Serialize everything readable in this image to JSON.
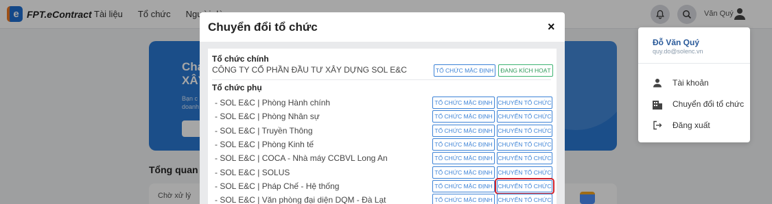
{
  "app": {
    "logo_text": "FPT.eContract",
    "logo_letter": "e",
    "nav": [
      "Tài liệu",
      "Tổ chức",
      "Người dùng"
    ],
    "user_name": "Văn Quý",
    "colors": {
      "brand": "#1f6fd1",
      "accent": "#f07a23",
      "highlight": "#d0202a"
    }
  },
  "background": {
    "hero_title_1": "Chả",
    "hero_title_2": "XÂY",
    "hero_sub_1": "Bạn c",
    "hero_sub_2": "doanh",
    "section_title": "Tổng quan",
    "card_label": "Chờ xử lý"
  },
  "user_menu": {
    "name": "Đỗ Văn Quý",
    "email": "quy.do@solenc.vn",
    "items": [
      {
        "label": "Tài khoản",
        "icon": "user-icon"
      },
      {
        "label": "Chuyển đổi tổ chức",
        "icon": "building-icon"
      },
      {
        "label": "Đăng xuất",
        "icon": "logout-icon"
      }
    ]
  },
  "modal": {
    "title": "Chuyển đổi tổ chức",
    "close": "×",
    "main_heading": "Tổ chức chính",
    "main_org": "CÔNG TY CỔ PHẦN ĐẦU TƯ XÂY DỰNG SOL E&C",
    "main_default_btn": "TỔ CHỨC MẶC ĐỊNH",
    "main_active_btn": "ĐANG KÍCH HOẠT",
    "sub_heading": "Tổ chức phụ",
    "default_btn": "TỔ CHỨC MẶC ĐỊNH",
    "switch_btn": "CHUYỂN TỔ CHỨC",
    "sub_orgs": [
      {
        "name": "-  SOL E&C | Phòng Hành chính",
        "highlighted": false
      },
      {
        "name": "-  SOL E&C | Phòng Nhân sự",
        "highlighted": false
      },
      {
        "name": "-  SOL E&C | Truyền Thông",
        "highlighted": false
      },
      {
        "name": "-  SOL E&C | Phòng Kinh tế",
        "highlighted": false
      },
      {
        "name": "-  SOL E&C | COCA - Nhà máy CCBVL Long An",
        "highlighted": false
      },
      {
        "name": "-  SOL E&C | SOLUS",
        "highlighted": false
      },
      {
        "name": "-  SOL E&C | Pháp Chế - Hệ thống",
        "highlighted": true
      },
      {
        "name": "-  SOL E&C | Văn phòng đại diện DQM - Đà Lạt",
        "highlighted": false
      }
    ]
  }
}
